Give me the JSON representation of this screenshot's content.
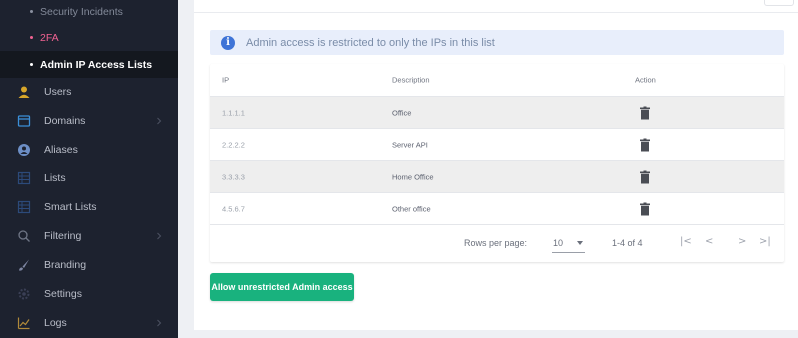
{
  "sidebar": {
    "sub_items": [
      {
        "label": "Security Incidents"
      },
      {
        "label": "2FA"
      },
      {
        "label": "Admin IP Access Lists"
      }
    ],
    "nav_items": [
      {
        "label": "Users",
        "icon": "user-icon"
      },
      {
        "label": "Domains",
        "icon": "window-icon"
      },
      {
        "label": "Aliases",
        "icon": "alias-icon"
      },
      {
        "label": "Lists",
        "icon": "list-icon"
      },
      {
        "label": "Smart Lists",
        "icon": "smart-list-icon"
      },
      {
        "label": "Filtering",
        "icon": "search-icon"
      },
      {
        "label": "Branding",
        "icon": "brush-icon"
      },
      {
        "label": "Settings",
        "icon": "gear-icon"
      },
      {
        "label": "Logs",
        "icon": "chart-icon"
      }
    ]
  },
  "info": {
    "text": "Admin access is restricted to only the IPs in this list"
  },
  "table": {
    "headers": {
      "ip": "IP",
      "description": "Description",
      "action": "Action"
    },
    "rows": [
      {
        "ip": "1.1.1.1",
        "description": "Office"
      },
      {
        "ip": "2.2.2.2",
        "description": "Server API"
      },
      {
        "ip": "3.3.3.3",
        "description": "Home Office"
      },
      {
        "ip": "4.5.6.7",
        "description": "Other office"
      }
    ]
  },
  "pagination": {
    "rows_per_page_label": "Rows per page:",
    "rows_per_page": "10",
    "range": "1-4 of 4",
    "first": "|<",
    "prev": "<",
    "next": ">",
    "last": ">|"
  },
  "actions": {
    "allow_button": "Allow unrestricted Admin access"
  },
  "colors": {
    "sidebar_bg": "#1d222f",
    "accent_green": "#19b27e",
    "highlight_pink": "#f06292",
    "info_blue": "#3f74d7"
  }
}
